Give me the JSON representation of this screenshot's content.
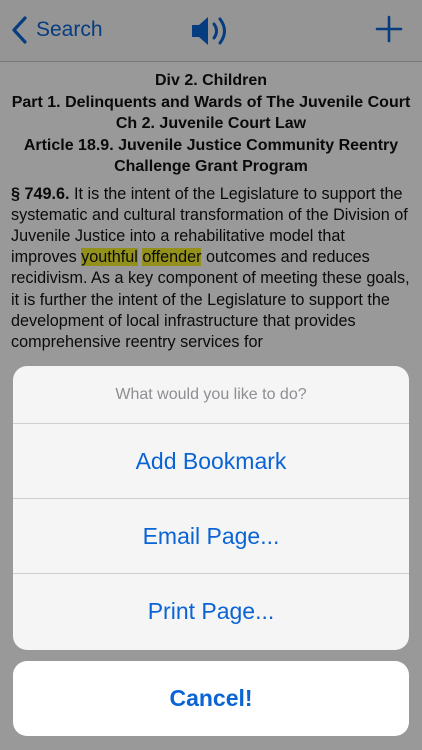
{
  "nav": {
    "back_label": "Search",
    "back_icon": "chevron-left-icon",
    "speaker_icon": "speaker-icon",
    "add_icon": "plus-icon"
  },
  "content": {
    "headings": [
      "Div 2. Children",
      "Part 1. Delinquents and Wards of The Juvenile Court",
      "Ch 2. Juvenile Court Law",
      "Article 18.9. Juvenile Justice Community Reentry Challenge Grant Program"
    ],
    "section_number": "§ 749.6.",
    "body_part1": " It is the intent of the Legislature to support the systematic and cultural transformation of the Division of Juvenile Justice into a rehabilitative model that improves ",
    "highlight1": "youthful",
    "highlight2": "offender",
    "body_part2": " outcomes and reduces recidivism. As a key component of meeting these goals, it is further the intent of the Legislature to support the development of local infrastructure that provides comprehensive reentry services for"
  },
  "sheet": {
    "title": "What would you like to do?",
    "options": [
      "Add Bookmark",
      "Email Page...",
      "Print Page..."
    ],
    "cancel_label": "Cancel!"
  },
  "colors": {
    "accent": "#0a64d6",
    "highlight": "#f6f12e"
  }
}
